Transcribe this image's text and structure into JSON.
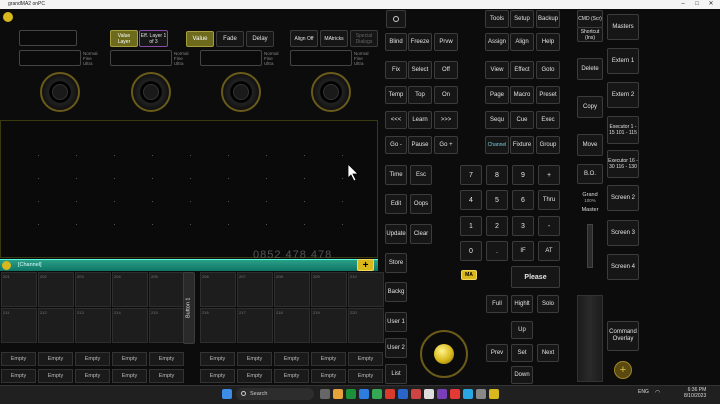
{
  "window": {
    "title": "grandMA2 onPC"
  },
  "top_buttons": {
    "value_layer": "Value Layer",
    "eff_layer": "Eff. Layer 1 of 3",
    "value": "Value",
    "fade": "Fade",
    "delay": "Delay",
    "align_off": "Align Off",
    "matricks": "MAtricks",
    "special": "Special Dialogs"
  },
  "encoder_labels": {
    "normal": "Normal",
    "fine": "Fine",
    "ultra": "Ultra"
  },
  "channel": {
    "label": "[Channel]"
  },
  "watermark": "0852 478 478",
  "fixture_numbers": [
    "201",
    "202",
    "203",
    "204",
    "205",
    "206",
    "207",
    "208",
    "209",
    "210",
    "211",
    "212",
    "213",
    "214",
    "215",
    "216",
    "217",
    "218",
    "219",
    "220"
  ],
  "button_strip": "Button 1",
  "empty_label": "Empty",
  "cmd": {
    "blind": "Blind",
    "freeze": "Freeze",
    "prvw": "Prvw",
    "tools": "Tools",
    "setup": "Setup",
    "backup": "Backup",
    "assign": "Assign",
    "align": "Align",
    "help": "Help",
    "fix": "Fix",
    "select": "Select",
    "off": "Off",
    "view": "View",
    "effect": "Effect",
    "goto": "Goto",
    "temp": "Temp",
    "top": "Top",
    "on": "On",
    "page": "Page",
    "macro": "Macro",
    "preset": "Preset",
    "back": "<<<",
    "learn": "Learn",
    "fwd": ">>>",
    "sequ": "Sequ",
    "cue": "Cue",
    "exec": "Exec",
    "gominus": "Go -",
    "pause": "Pause",
    "goplus": "Go +",
    "channel": "Channel",
    "fixture": "Fixture",
    "group": "Group",
    "time": "Time",
    "esc": "Esc",
    "edit": "Edit",
    "oops": "Oops",
    "update": "Update",
    "clear": "Clear",
    "store": "Store",
    "backg": "Backg",
    "user1": "User 1",
    "user2": "User 2",
    "list": "List",
    "thru": "Thru",
    "plus": "+",
    "minus": "-",
    "at": "AT",
    "if": "IF",
    "dot": ".",
    "ma": "MA",
    "please": "Please",
    "full": "Full",
    "highlt": "Highlt",
    "solo": "Solo",
    "up": "Up",
    "prev": "Prev",
    "set": "Set",
    "next": "Next",
    "down": "Down"
  },
  "keypad": [
    "7",
    "8",
    "9",
    "4",
    "5",
    "6",
    "1",
    "2",
    "3",
    "0"
  ],
  "right_col": {
    "cmd_scr": "CMD (Scr)",
    "shortcut": "Shortcut (Ins)",
    "delete": "Delete",
    "copy": "Copy",
    "move": "Move",
    "bo": "B.O.",
    "grand": "Grand",
    "grand_pct": "100%",
    "master": "Master"
  },
  "masters": {
    "masters": "Masters",
    "extern1": "Extern 1",
    "extern2": "Extern 2",
    "executor1": "Executor 1 - 15 101 - 115",
    "executor2": "Executor 16 - 30 116 - 130",
    "screen2": "Screen 2",
    "screen3": "Screen 3",
    "screen4": "Screen 4",
    "command_overlay": "Command Overlay"
  },
  "taskbar": {
    "search": "Search",
    "lang": "ENG",
    "time": "6:36 PM",
    "date": "8/10/2023"
  },
  "colors": {
    "olive": "#6d6a1c",
    "teal": "#2aa088",
    "yellow": "#d8b81c"
  }
}
